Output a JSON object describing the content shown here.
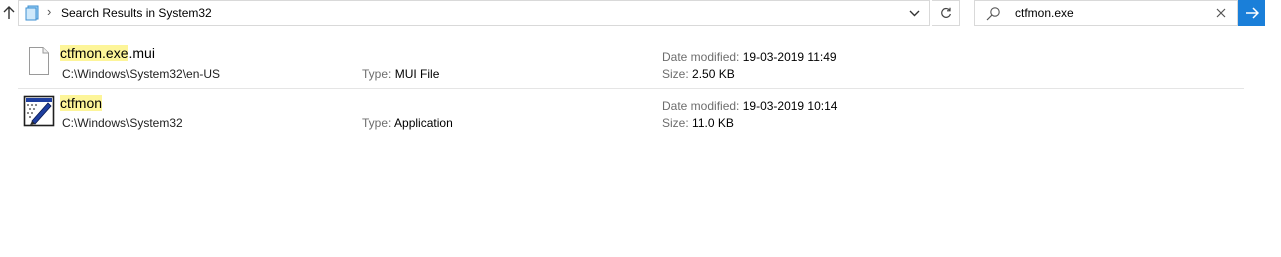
{
  "address_bar": {
    "breadcrumb": "Search Results in System32",
    "icons": {
      "up": "arrow-up-icon",
      "folder": "folder-icon",
      "separator": "chevron-right-icon",
      "dropdown": "chevron-down-icon",
      "refresh": "refresh-icon"
    }
  },
  "search": {
    "value": "ctfmon.exe",
    "icons": {
      "search": "search-icon",
      "clear": "close-icon",
      "go": "arrow-right-icon"
    }
  },
  "labels": {
    "type": "Type:",
    "date_modified": "Date modified:",
    "size": "Size:"
  },
  "results": [
    {
      "name_highlight": "ctfmon.exe",
      "name_rest": ".mui",
      "path": "C:\\Windows\\System32\\en-US",
      "type": "MUI File",
      "date_modified": "19-03-2019 11:49",
      "size": "2.50 KB",
      "icon": "blank-file-icon"
    },
    {
      "name_highlight": "ctfmon",
      "name_rest": "",
      "path": "C:\\Windows\\System32",
      "type": "Application",
      "date_modified": "19-03-2019 10:14",
      "size": "11.0 KB",
      "icon": "application-icon"
    }
  ],
  "colors": {
    "highlight": "#fdf599",
    "accent": "#1a7fd9",
    "border": "#d9d9d9",
    "label_gray": "#6d6d6d"
  }
}
